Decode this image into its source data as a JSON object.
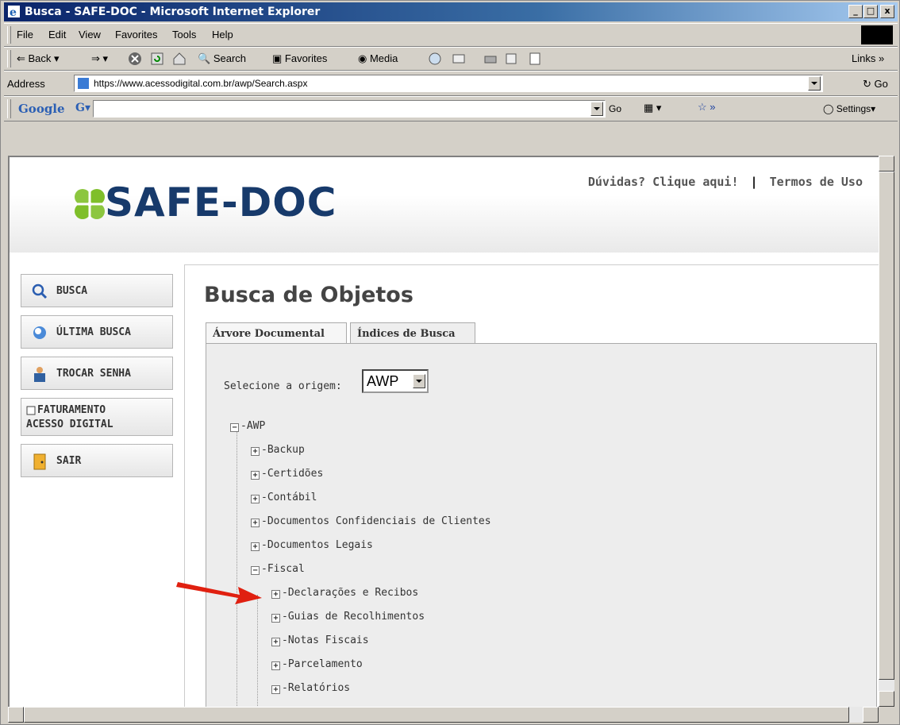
{
  "window": {
    "title": "Busca - SAFE-DOC - Microsoft Internet Explorer",
    "minimize": "_",
    "maximize": "□",
    "close": "x"
  },
  "menu": [
    "File",
    "Edit",
    "View",
    "Favorites",
    "Tools",
    "Help"
  ],
  "toolbar": {
    "back": "Back",
    "search": "Search",
    "favorites": "Favorites",
    "media": "Media",
    "links": "Links"
  },
  "addressbar": {
    "label": "Address",
    "url": "https://www.acessodigital.com.br/awp/Search.aspx",
    "go": "Go"
  },
  "googlebar": {
    "brand": "Google",
    "go": "Go",
    "settings": "Settings"
  },
  "site": {
    "logo": "SAFE-DOC",
    "help_link": "Dúvidas? Clique aqui!",
    "separator": "|",
    "terms_link": "Termos de Uso",
    "colors": {
      "logo_green": "#7fbf2a",
      "logo_blue": "#173a6b"
    }
  },
  "sidebar": [
    {
      "label": "BUSCA",
      "icon": "magnifier-icon"
    },
    {
      "label": "ÚLTIMA BUSCA",
      "icon": "refresh-search-icon"
    },
    {
      "label": "TROCAR SENHA",
      "icon": "user-icon"
    },
    {
      "label_line1": "FATURAMENTO",
      "label_line2": "ACESSO DIGITAL",
      "icon": "document-icon"
    },
    {
      "label": "SAIR",
      "icon": "exit-door-icon"
    }
  ],
  "main": {
    "title": "Busca de Objetos",
    "tabs": [
      "Árvore Documental",
      "Índices de Busca"
    ],
    "origin_label": "Selecione a origem:",
    "origin_value": "AWP",
    "tree": [
      {
        "label": "AWP",
        "toggle": "−"
      },
      {
        "label": "Backup",
        "toggle": "+"
      },
      {
        "label": "Certidões",
        "toggle": "+"
      },
      {
        "label": "Contábil",
        "toggle": "+"
      },
      {
        "label": "Documentos Confidenciais de Clientes",
        "toggle": "+"
      },
      {
        "label": "Documentos Legais",
        "toggle": "+"
      },
      {
        "label": "Fiscal",
        "toggle": "−"
      },
      {
        "label": "Declarações e Recibos",
        "toggle": "+"
      },
      {
        "label": "Guias de Recolhimentos",
        "toggle": "+"
      },
      {
        "label": "Notas Fiscais",
        "toggle": "+"
      },
      {
        "label": "Parcelamento",
        "toggle": "+"
      },
      {
        "label": "Relatórios",
        "toggle": "+"
      }
    ]
  }
}
